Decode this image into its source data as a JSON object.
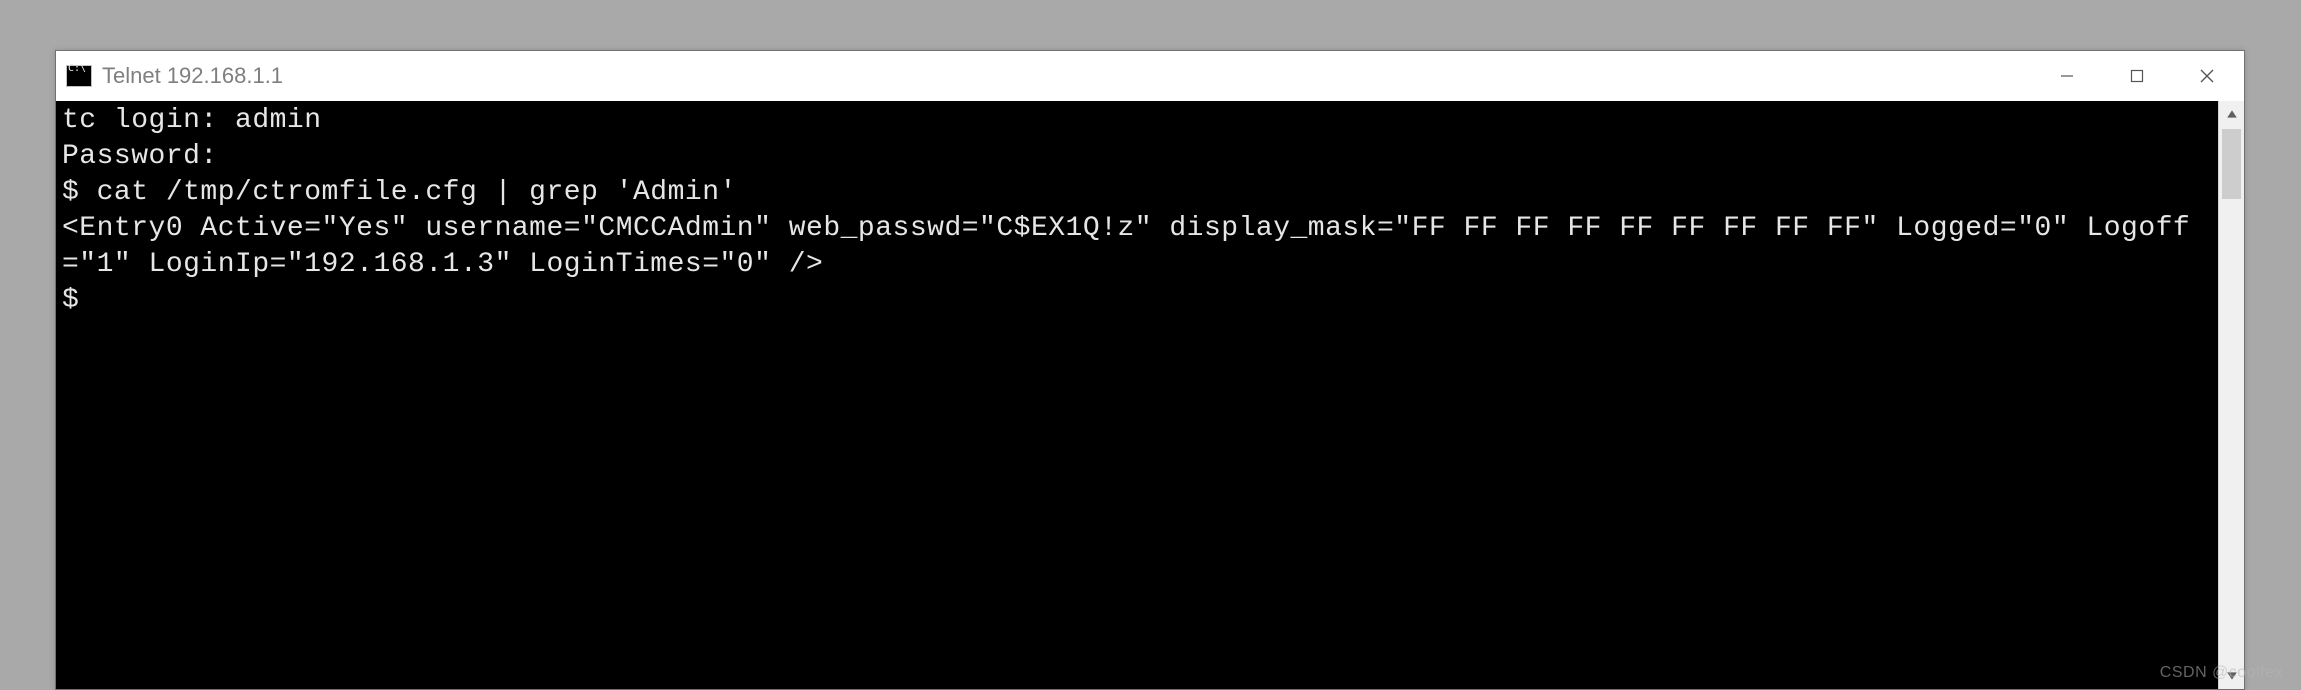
{
  "window": {
    "title": "Telnet 192.168.1.1"
  },
  "terminal": {
    "lines": [
      "tc login: admin",
      "Password:",
      "$ cat /tmp/ctromfile.cfg | grep 'Admin'",
      "<Entry0 Active=\"Yes\" username=\"CMCCAdmin\" web_passwd=\"C$EX1Q!z\" display_mask=\"FF FF FF FF FF FF FF FF FF\" Logged=\"0\" Logoff=\"1\" LoginIp=\"192.168.1.3\" LoginTimes=\"0\" />",
      "$"
    ]
  },
  "watermark": "CSDN @coolfex"
}
